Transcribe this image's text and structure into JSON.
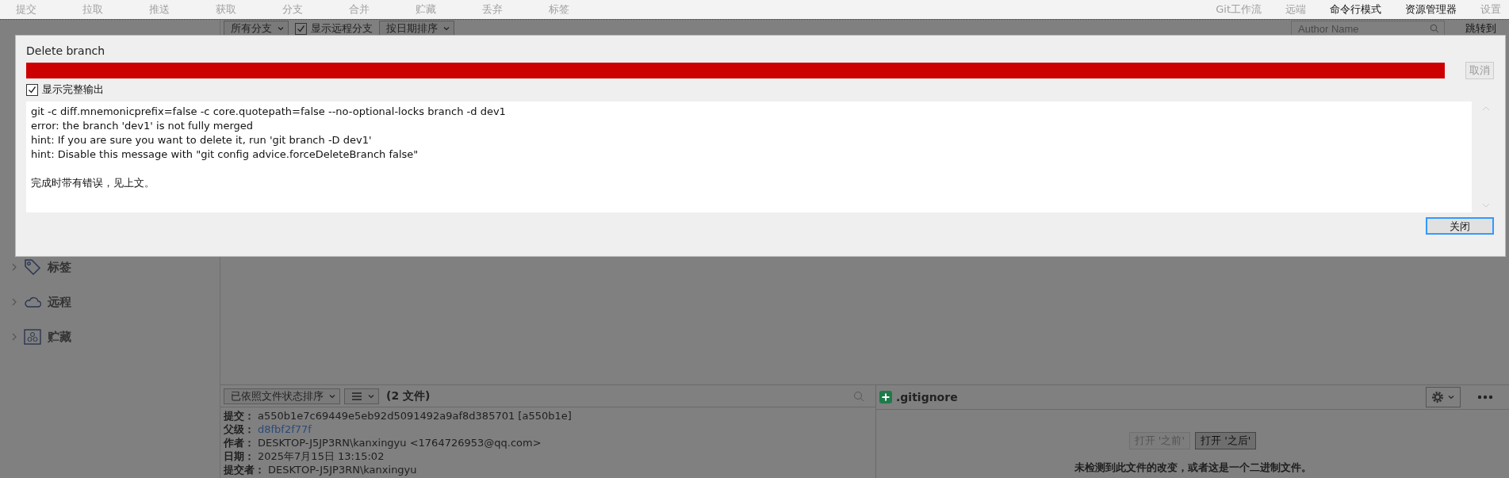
{
  "toolbar": {
    "left": [
      {
        "label": "提交",
        "disabled": true
      },
      {
        "label": "拉取",
        "disabled": true
      },
      {
        "label": "推送",
        "disabled": true
      },
      {
        "label": "获取",
        "disabled": true
      },
      {
        "label": "分支",
        "disabled": true
      },
      {
        "label": "合并",
        "disabled": true
      },
      {
        "label": "贮藏",
        "disabled": true
      },
      {
        "label": "丢弃",
        "disabled": true
      },
      {
        "label": "标签",
        "disabled": true
      }
    ],
    "right": [
      {
        "label": "Git工作流",
        "disabled": true
      },
      {
        "label": "远端",
        "disabled": true
      },
      {
        "label": "命令行模式",
        "disabled": false
      },
      {
        "label": "资源管理器",
        "disabled": false
      },
      {
        "label": "设置",
        "disabled": true
      }
    ]
  },
  "filter_bar": {
    "branch_filter": "所有分支",
    "show_remote": {
      "label": "显示远程分支",
      "checked": true
    },
    "sort": "按日期排序",
    "author_search": {
      "placeholder": "Author Name"
    },
    "jump_to": "跳转到"
  },
  "sidebar": {
    "items": [
      {
        "kind": "tag",
        "label": "标签",
        "expanded": false
      },
      {
        "kind": "remote",
        "label": "远程",
        "expanded": false
      },
      {
        "kind": "stash",
        "label": "贮藏",
        "expanded": false
      }
    ]
  },
  "files_pane": {
    "sort": "已依照文件状态排序",
    "count": "(2 文件)",
    "details": [
      {
        "label": "提交：",
        "value": "a550b1e7c69449e5eb92d5091492a9af8d385701 [a550b1e]",
        "link": false
      },
      {
        "label": "父级：",
        "value": "d8fbf2f77f",
        "link": true
      },
      {
        "label": "作者：",
        "value": "DESKTOP-J5JP3RN\\kanxingyu <1764726953@qq.com>",
        "link": false
      },
      {
        "label": "日期：",
        "value": "2025年7月15日 13:15:02",
        "link": false
      },
      {
        "label": "提交者：",
        "value": "DESKTOP-J5JP3RN\\kanxingyu",
        "link": false
      }
    ]
  },
  "diff_pane": {
    "file": ".gitignore",
    "buttons": [
      {
        "label": "打开 '之前'",
        "disabled": true
      },
      {
        "label": "打开 '之后'",
        "disabled": false
      }
    ],
    "message": "未检测到此文件的改变，或者这是一个二进制文件。"
  },
  "dialog": {
    "title": "Delete branch",
    "progress": {
      "level": 1,
      "color": "#cc0000"
    },
    "cancel": {
      "label": "取消",
      "disabled": true
    },
    "show_full_output": {
      "label": "显示完整输出",
      "checked": true
    },
    "output": [
      "git -c diff.mnemonicprefix=false -c core.quotepath=false --no-optional-locks branch -d dev1",
      "error: the branch 'dev1' is not fully merged",
      "hint: If you are sure you want to delete it, run 'git branch -D dev1'",
      "hint: Disable this message with \"git config advice.forceDeleteBranch false\""
    ],
    "status": "完成时带有错误，见上文。",
    "close": {
      "label": "关闭",
      "focused": true
    }
  }
}
